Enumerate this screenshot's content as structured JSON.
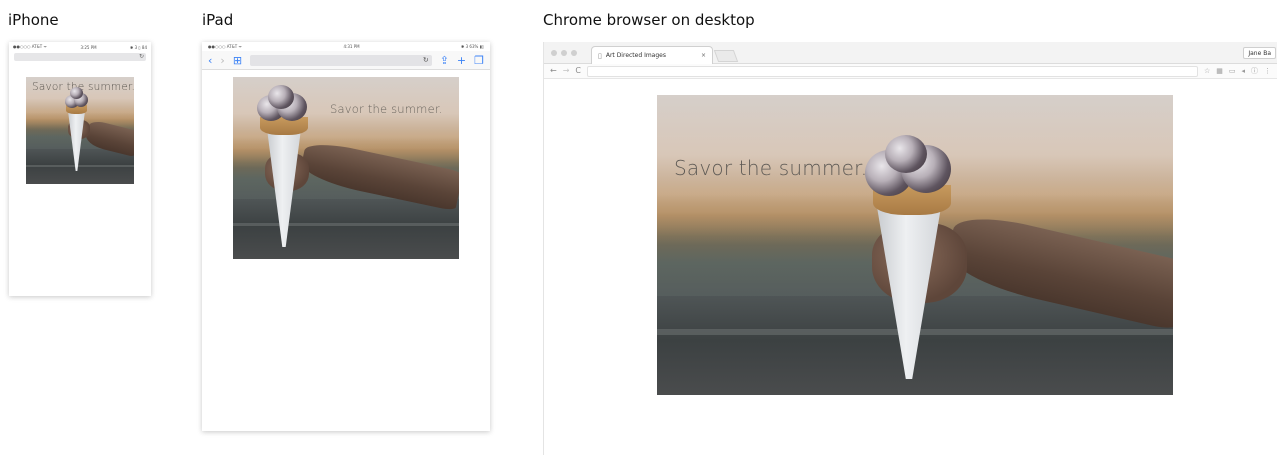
{
  "labels": {
    "iphone": "iPhone",
    "ipad": "iPad",
    "desktop": "Chrome browser on desktop"
  },
  "scene": {
    "headline": "Savor the summer."
  },
  "iphone": {
    "carrier": "●●○○○ AT&T ᯤ",
    "time": "3:25 PM",
    "battery": "✱ 3 ▯ 84",
    "reload_icon": "↻"
  },
  "ipad": {
    "carrier": "●●○○○ AT&T ᯤ",
    "time": "4:31 PM",
    "battery": "✱ 3 63% ▮▯",
    "back_icon": "‹",
    "forward_icon": "›",
    "bookmarks_icon": "⊞",
    "reload_icon": "↻",
    "share_icon": "⇪",
    "add_icon": "+",
    "tabs_icon": "❐"
  },
  "chrome": {
    "tab_title": "Art Directed Images",
    "tab_close": "×",
    "profile": "Jane Ba",
    "back_icon": "←",
    "forward_icon": "→",
    "reload_icon": "C",
    "star_icon": "☆"
  }
}
